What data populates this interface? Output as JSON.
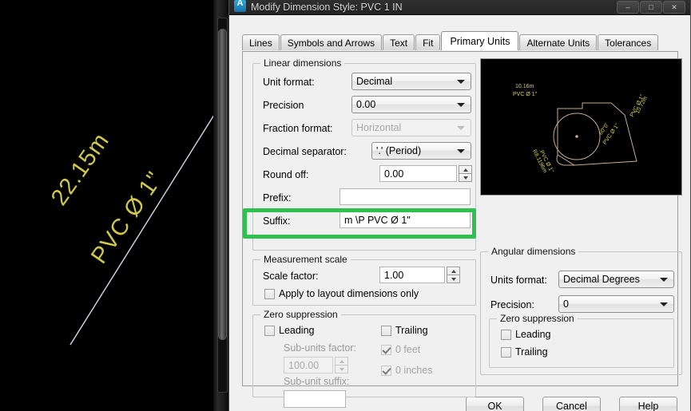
{
  "window": {
    "title": "Modify Dimension Style: PVC 1 IN",
    "icon": "autocad-app-icon",
    "minimize_label": "–",
    "maximize_label": "□",
    "close_label": "✕"
  },
  "tabs": [
    {
      "label": "Lines",
      "active": false
    },
    {
      "label": "Symbols and Arrows",
      "active": false
    },
    {
      "label": "Text",
      "active": false
    },
    {
      "label": "Fit",
      "active": false
    },
    {
      "label": "Primary Units",
      "active": true
    },
    {
      "label": "Alternate Units",
      "active": false
    },
    {
      "label": "Tolerances",
      "active": false
    }
  ],
  "linear_dimensions": {
    "group_title": "Linear dimensions",
    "unit_format": {
      "label": "Unit format:",
      "value": "Decimal"
    },
    "precision": {
      "label": "Precision",
      "value": "0.00"
    },
    "fraction_format": {
      "label": "Fraction format:",
      "value": "Horizontal"
    },
    "decimal_separator": {
      "label": "Decimal separator:",
      "value": "'.' (Period)"
    },
    "round_off": {
      "label": "Round off:",
      "value": "0.00"
    },
    "prefix": {
      "label": "Prefix:",
      "value": ""
    },
    "suffix": {
      "label": "Suffix:",
      "value": "m \\P PVC Ø 1\""
    }
  },
  "measurement_scale": {
    "group_title": "Measurement scale",
    "scale_factor": {
      "label": "Scale factor:",
      "value": "1.00"
    },
    "apply_layout_only": {
      "label": "Apply to layout dimensions only",
      "checked": false
    }
  },
  "zero_suppression_linear": {
    "group_title": "Zero suppression",
    "leading": {
      "label": "Leading",
      "checked": false
    },
    "trailing": {
      "label": "Trailing",
      "checked": false
    },
    "sub_units_factor": {
      "label": "Sub-units factor:",
      "value": "100.00"
    },
    "sub_unit_suffix": {
      "label": "Sub-unit suffix:",
      "value": ""
    },
    "zero_feet": {
      "label": "0 feet",
      "checked": true
    },
    "zero_inches": {
      "label": "0 inches",
      "checked": true
    }
  },
  "angular_dimensions": {
    "group_title": "Angular dimensions",
    "units_format": {
      "label": "Units format:",
      "value": "Decimal Degrees"
    },
    "precision": {
      "label": "Precision:",
      "value": "0"
    },
    "zero_suppression": {
      "group_title": "Zero suppression",
      "leading": {
        "label": "Leading",
        "checked": false
      },
      "trailing": {
        "label": "Trailing",
        "checked": false
      }
    }
  },
  "preview": {
    "labels": {
      "top_left_line1": "10.16m",
      "top_left_line2": "PVC Ø 1\"",
      "right_line1": "10.72m",
      "right_line2": "PVC Ø 1\"",
      "inner_line1": "60°0'",
      "inner_line2": "PVC Ø 1\"",
      "bottom_line1": "R8.1196m",
      "bottom_line2": "PVC Ø 1\""
    }
  },
  "buttons": {
    "ok": "OK",
    "cancel": "Cancel",
    "help": "Help"
  },
  "cad_background": {
    "dimension_value": "22.15m",
    "dimension_suffix": "PVC Ø 1\""
  },
  "highlight": {
    "target": "round-off-row",
    "color": "#2fc04f"
  }
}
